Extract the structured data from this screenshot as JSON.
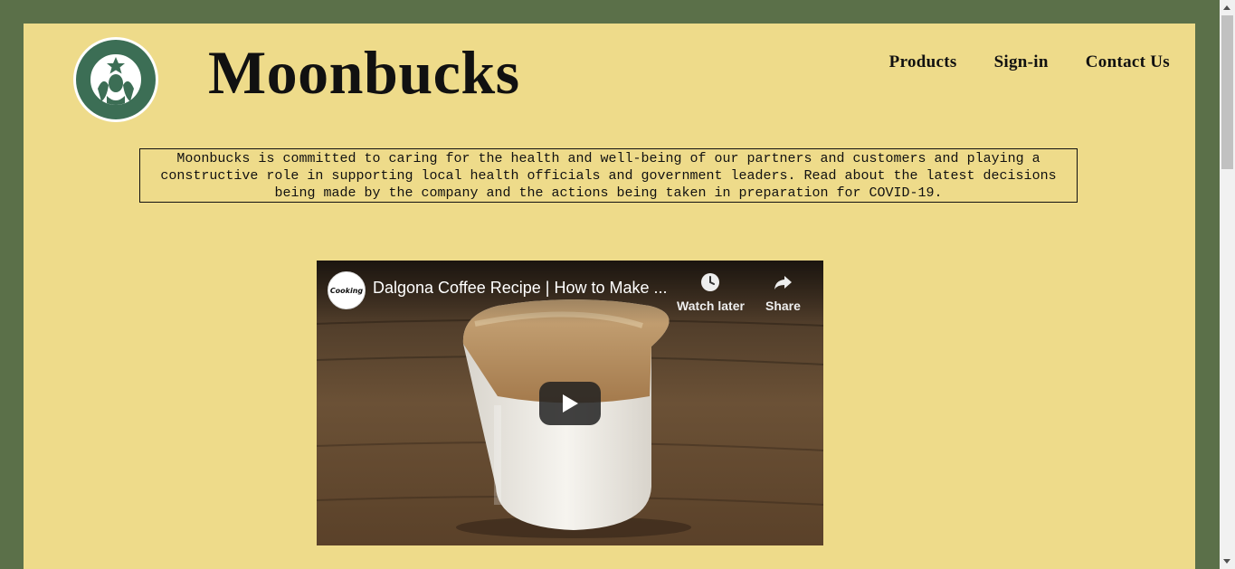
{
  "header": {
    "brand": "Moonbucks",
    "logo_icon": "siren-logo-icon",
    "nav": [
      "Products",
      "Sign-in",
      "Contact Us"
    ]
  },
  "notice": {
    "text": "Moonbucks is committed to caring for the health and well-being of our partners and customers and playing a constructive role in supporting local health officials and government leaders. Read about the latest decisions being made by the company and the actions being taken in preparation for COVID-19."
  },
  "video": {
    "title": "Dalgona Coffee Recipe | How to Make ...",
    "channel_badge": "Cooking",
    "watch_later_label": "Watch later",
    "share_label": "Share",
    "play_icon": "play-icon"
  },
  "colors": {
    "outer_background": "#5b7049",
    "page_background": "#eedb8a",
    "logo_green": "#3c6e55"
  }
}
